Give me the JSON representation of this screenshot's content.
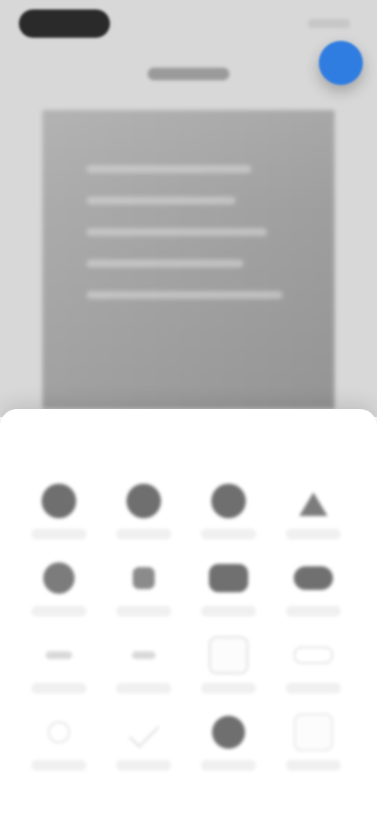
{
  "ui": {
    "top_area": {
      "status_pill_icon": "status-pill",
      "status_indicators_icon": "status-indicators",
      "title": "",
      "fab_icon": "action-fab"
    },
    "sheet": {
      "title": "",
      "close_label": "",
      "actions": [
        {
          "name": "action-1",
          "icon": "circle",
          "label": ""
        },
        {
          "name": "action-2",
          "icon": "circle",
          "label": ""
        },
        {
          "name": "action-3",
          "icon": "circle",
          "label": ""
        },
        {
          "name": "action-4",
          "icon": "triangle",
          "label": ""
        },
        {
          "name": "action-5",
          "icon": "circle",
          "label": ""
        },
        {
          "name": "action-6",
          "icon": "small-square",
          "label": ""
        },
        {
          "name": "action-7",
          "icon": "rounded-rect",
          "label": ""
        },
        {
          "name": "action-8",
          "icon": "pill",
          "label": ""
        },
        {
          "name": "action-9",
          "icon": "dash",
          "label": ""
        },
        {
          "name": "action-10",
          "icon": "dash",
          "label": ""
        },
        {
          "name": "action-11",
          "icon": "outline-box",
          "label": ""
        },
        {
          "name": "action-12",
          "icon": "outline-pill",
          "label": ""
        },
        {
          "name": "action-13",
          "icon": "outline-circle",
          "label": ""
        },
        {
          "name": "action-14",
          "icon": "check",
          "label": ""
        },
        {
          "name": "action-15",
          "icon": "circle",
          "label": ""
        },
        {
          "name": "action-16",
          "icon": "outline-box",
          "label": ""
        }
      ]
    },
    "colors": {
      "accent": "#2f7de1",
      "top_background": "#d8d8d8",
      "preview_gray": "#a6a6a6",
      "sheet_background": "#ffffff"
    }
  }
}
